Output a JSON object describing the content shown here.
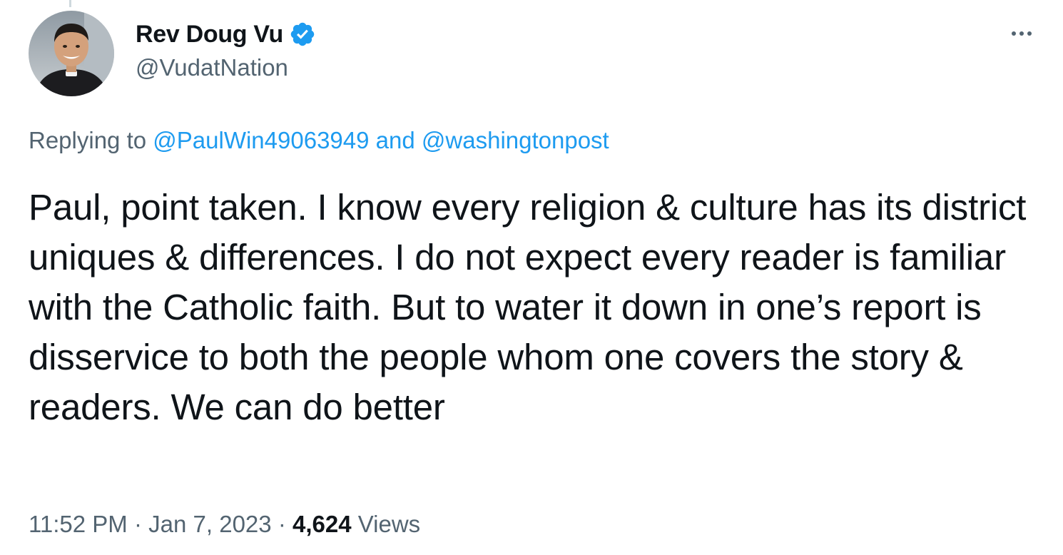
{
  "user": {
    "display_name": "Rev Doug Vu",
    "handle": "@VudatNation",
    "verified_icon": "verified-badge-icon",
    "badge_color": "#1d9bf0"
  },
  "reply_context": {
    "prefix": "Replying to",
    "mention_1": "@PaulWin49063949",
    "connector": "and",
    "mention_2": "@washingtonpost"
  },
  "tweet": {
    "text": "Paul, point taken. I know every religion & culture has its district uniques & differences. I do not expect every reader is familiar with the Catholic faith. But to water it down in one’s report is disservice to both the people whom one covers the story & readers. We can do better"
  },
  "meta": {
    "time": "11:52 PM",
    "separator": "·",
    "date": "Jan 7, 2023",
    "views_count": "4,624",
    "views_label": "Views"
  },
  "colors": {
    "text_primary": "#0f1419",
    "text_secondary": "#536471",
    "link": "#1d9bf0"
  }
}
